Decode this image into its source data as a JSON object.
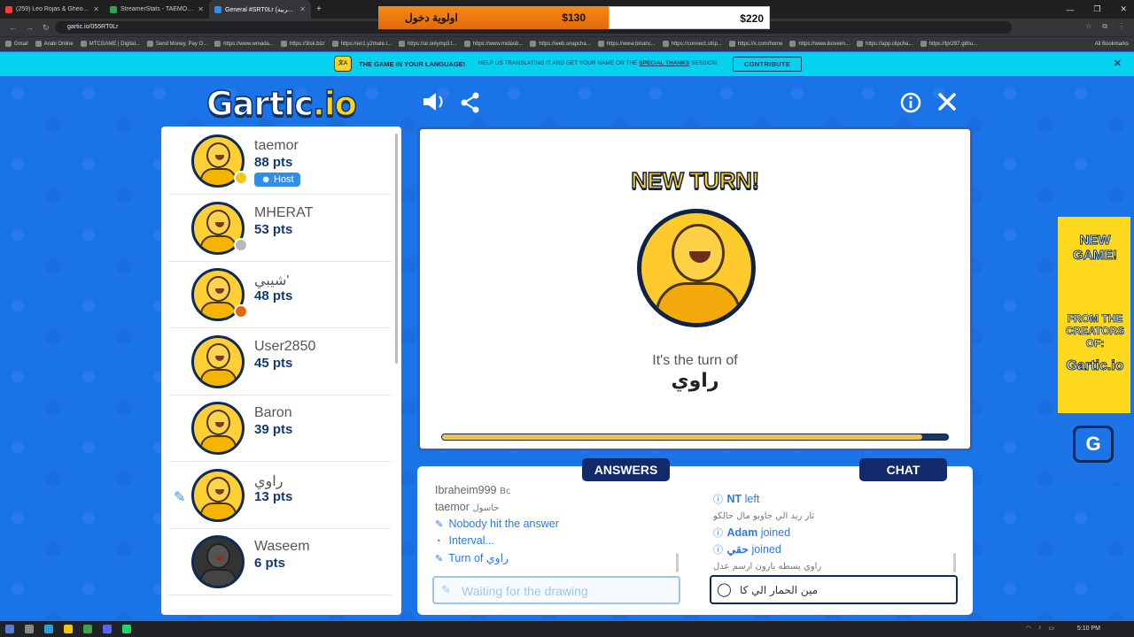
{
  "browser": {
    "tabs": [
      {
        "title": "(259) Leo Rojas & Gheorghe",
        "color": "#ff3b30"
      },
      {
        "title": "StreamerStats - TAEMOR Stream",
        "color": "#2ea44f"
      },
      {
        "title": "General #SRT0Lr (العربية) - Gartic",
        "color": "#2f8fe8"
      }
    ],
    "url": "gartic.io/055RT0Lr",
    "bookmarks": [
      "Gmail",
      "Arabi Online",
      "MTCGAME | Digital...",
      "Send Money, Pay O...",
      "https://www.wmada...",
      "https://3isk.biz/",
      "https://en1.y2mate.i...",
      "https://ar.onlymp3.t...",
      "https://www.midasb...",
      "https://web.snapcha...",
      "https://www.binanc...",
      "https://connect.strip...",
      "https://x.com/home",
      "https://www.ikoveim...",
      "https://app.clipcha...",
      "https://tpr297.githu..."
    ],
    "all_bookmarks": "All Bookmarks"
  },
  "overlay_ad": {
    "arabic_text": "اولوية دخول",
    "price1": "$130",
    "price2": "$220"
  },
  "banner": {
    "headline": "THE GAME IN YOUR LANGUAGE!",
    "text": "HELP US TRANSLATING IT AND GET YOUR NAME ON THE",
    "link": "SPECIAL THANKS",
    "after": "SESSION",
    "contribute": "CONTRIBUTE"
  },
  "logo": {
    "main": "Gartic",
    "suffix": ".io"
  },
  "players": [
    {
      "name": "taemor",
      "pts": "88 pts",
      "host": "Host",
      "dot": "#f5c518",
      "dark": false,
      "drawing": false
    },
    {
      "name": "MHERAT",
      "pts": "53 pts",
      "dot": "#b9b9b9",
      "dark": false,
      "drawing": false
    },
    {
      "name": "شيبي'",
      "pts": "48 pts",
      "dot": "#e5680c",
      "dark": false,
      "drawing": false
    },
    {
      "name": "User2850",
      "pts": "45 pts",
      "dark": false,
      "drawing": false
    },
    {
      "name": "Baron",
      "pts": "39 pts",
      "dark": false,
      "drawing": false
    },
    {
      "name": "راوي",
      "pts": "13 pts",
      "dark": false,
      "drawing": true
    },
    {
      "name": "Waseem",
      "pts": "6 pts",
      "dark": true,
      "drawing": false
    }
  ],
  "turn": {
    "title": "NEW TURN!",
    "label": "It's the turn of",
    "player": "راوي",
    "progress": 0.95
  },
  "answers": {
    "tab": "ANSWERS",
    "lines": [
      {
        "user": "Ibraheim999",
        "text": "Bc",
        "type": "msg"
      },
      {
        "user": "taemor",
        "text": "حاسول",
        "type": "msg"
      },
      {
        "text": "Nobody hit the answer",
        "type": "system",
        "icon": "pencil"
      },
      {
        "text": "Interval...",
        "type": "system",
        "icon": "clock"
      },
      {
        "text": "Turn of راوي",
        "type": "system",
        "icon": "pencil"
      }
    ],
    "placeholder": "Waiting for the drawing"
  },
  "chat": {
    "tab": "CHAT",
    "lines": [
      {
        "name": "NT",
        "action": "left",
        "type": "info"
      },
      {
        "text": "ثار ريد الي جاوبو مال حالكو",
        "type": "msg"
      },
      {
        "name": "Adam",
        "action": "joined",
        "type": "info"
      },
      {
        "name": "حقي",
        "action": "joined",
        "type": "info"
      },
      {
        "text": "راوي يسطه بارون ارسم عدل",
        "type": "msg"
      }
    ],
    "input_value": "مين الحمار الي كا"
  },
  "side_ad": {
    "line1": "NEW GAME!",
    "line2": "FROM THE CREATORS OF:",
    "brand": "Gartic.io",
    "button": "G"
  },
  "taskbar": {
    "time": "5:10 PM"
  }
}
